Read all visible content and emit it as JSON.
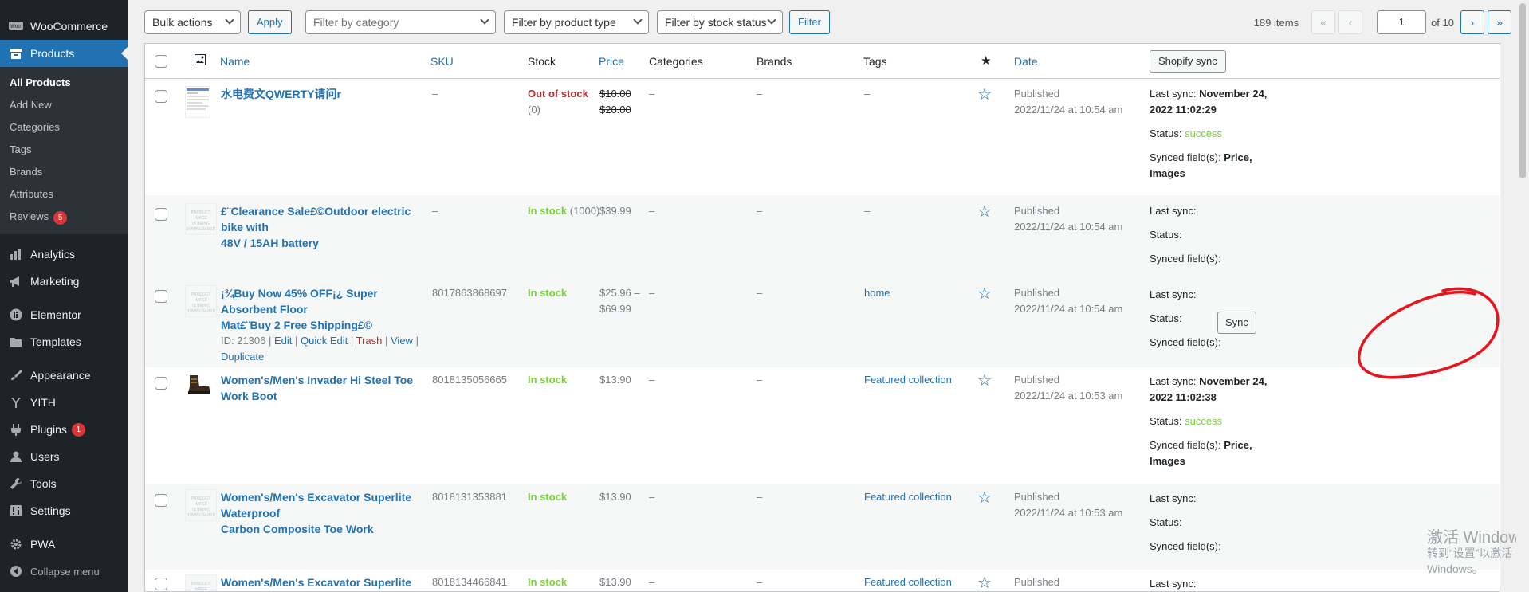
{
  "sidebar": {
    "woocommerce": "WooCommerce",
    "products": "Products",
    "sub": [
      "All Products",
      "Add New",
      "Categories",
      "Tags",
      "Brands",
      "Attributes",
      "Reviews"
    ],
    "reviews_badge": "5",
    "analytics": "Analytics",
    "marketing": "Marketing",
    "elementor": "Elementor",
    "templates": "Templates",
    "appearance": "Appearance",
    "yith": "YITH",
    "plugins": "Plugins",
    "plugins_badge": "1",
    "users": "Users",
    "tools": "Tools",
    "settings": "Settings",
    "pwa": "PWA",
    "collapse": "Collapse menu"
  },
  "toolbar": {
    "bulk_actions": "Bulk actions",
    "apply": "Apply",
    "filter_category": "Filter by category",
    "filter_type": "Filter by product type",
    "filter_stock": "Filter by stock status",
    "filter": "Filter",
    "items": "189 items",
    "first": "«",
    "prev": "‹",
    "page": "1",
    "of": "of 10",
    "next": "›",
    "last": "»"
  },
  "columns": {
    "name": "Name",
    "sku": "SKU",
    "stock": "Stock",
    "price": "Price",
    "categories": "Categories",
    "brands": "Brands",
    "tags": "Tags",
    "date": "Date",
    "shopify_sync": "Shopify sync"
  },
  "rows": [
    {
      "name": "水电费文QWERTY请问r",
      "name2": "",
      "sku": "–",
      "stock": "Out of stock",
      "stock_qty": "(0)",
      "price": "$10.00",
      "price2": "$20.00",
      "categories": "–",
      "brands": "–",
      "tags": "–",
      "date_status": "Published",
      "date": "2022/11/24 at 10:54 am",
      "sync_label": "Last sync:",
      "sync_value": "November 24,",
      "sync_value2": "2022 11:02:29",
      "status_label": "Status:",
      "status_value": "success",
      "fields_label": "Synced field(s):",
      "fields_value": "Price,",
      "fields_value2": "Images"
    },
    {
      "name": "£¨Clearance Sale£©Outdoor electric bike with",
      "name2": "48V / 15AH battery",
      "sku": "–",
      "stock": "In stock",
      "stock_qty": "(1000)",
      "price": "$39.99",
      "price2": "",
      "categories": "–",
      "brands": "–",
      "tags": "–",
      "date_status": "Published",
      "date": "2022/11/24 at 10:54 am",
      "sync_label": "Last sync:",
      "sync_value": "",
      "sync_value2": "",
      "status_label": "Status:",
      "status_value": "",
      "fields_label": "Synced field(s):",
      "fields_value": "",
      "fields_value2": ""
    },
    {
      "name": "¡¾Buy Now 45% OFF¡¿ Super Absorbent Floor",
      "name2": "Mat£¨Buy 2 Free Shipping£©",
      "sku": "8017863868697",
      "stock": "In stock",
      "stock_qty": "",
      "price": "$25.96 –",
      "price2": "$69.99",
      "categories": "–",
      "brands": "–",
      "tags": "home",
      "date_status": "Published",
      "date": "2022/11/24 at 10:54 am",
      "sync_label": "Last sync:",
      "sync_value": "",
      "sync_value2": "",
      "status_label": "Status:",
      "status_value": "",
      "fields_label": "Synced field(s):",
      "fields_value": "",
      "fields_value2": "",
      "id_text": "ID: 21306 |",
      "edit": "Edit",
      "quick_edit": "Quick Edit",
      "trash": "Trash",
      "view": "View",
      "duplicate": "Duplicate",
      "sync_button": "Sync"
    },
    {
      "name": "Women's/Men's Invader Hi Steel Toe Work Boot",
      "name2": "",
      "sku": "8018135056665",
      "stock": "In stock",
      "stock_qty": "",
      "price": "$13.90",
      "price2": "",
      "categories": "–",
      "brands": "–",
      "tags": "Featured collection",
      "date_status": "Published",
      "date": "2022/11/24 at 10:53 am",
      "sync_label": "Last sync:",
      "sync_value": "November 24,",
      "sync_value2": "2022 11:02:38",
      "status_label": "Status:",
      "status_value": "success",
      "fields_label": "Synced field(s):",
      "fields_value": "Price,",
      "fields_value2": "Images"
    },
    {
      "name": "Women's/Men's Excavator Superlite Waterproof",
      "name2": "Carbon Composite Toe Work",
      "sku": "8018131353881",
      "stock": "In stock",
      "stock_qty": "",
      "price": "$13.90",
      "price2": "",
      "categories": "–",
      "brands": "–",
      "tags": "Featured collection",
      "date_status": "Published",
      "date": "2022/11/24 at 10:53 am",
      "sync_label": "Last sync:",
      "sync_value": "",
      "sync_value2": "",
      "status_label": "Status:",
      "status_value": "",
      "fields_label": "Synced field(s):",
      "fields_value": "",
      "fields_value2": ""
    },
    {
      "name": "Women's/Men's Excavator Superlite Cool",
      "name2": "",
      "sku": "8018134466841",
      "stock": "In stock",
      "stock_qty": "",
      "price": "$13.90",
      "price2": "",
      "categories": "–",
      "brands": "–",
      "tags": "Featured collection",
      "date_status": "Published",
      "date": "",
      "sync_label": "Last sync:",
      "sync_value": "",
      "sync_value2": "",
      "status_label": "",
      "status_value": "",
      "fields_label": "",
      "fields_value": "",
      "fields_value2": ""
    }
  ],
  "watermark": {
    "line1": "激活 Windows",
    "line2": "转到“设置”以激活 Windows。"
  },
  "colors": {
    "sidebar_bg": "#1d2327",
    "accent": "#2271b1",
    "out_of_stock": "#b32d2e",
    "in_stock": "#7ad03a",
    "annotation": "#e8141b"
  }
}
